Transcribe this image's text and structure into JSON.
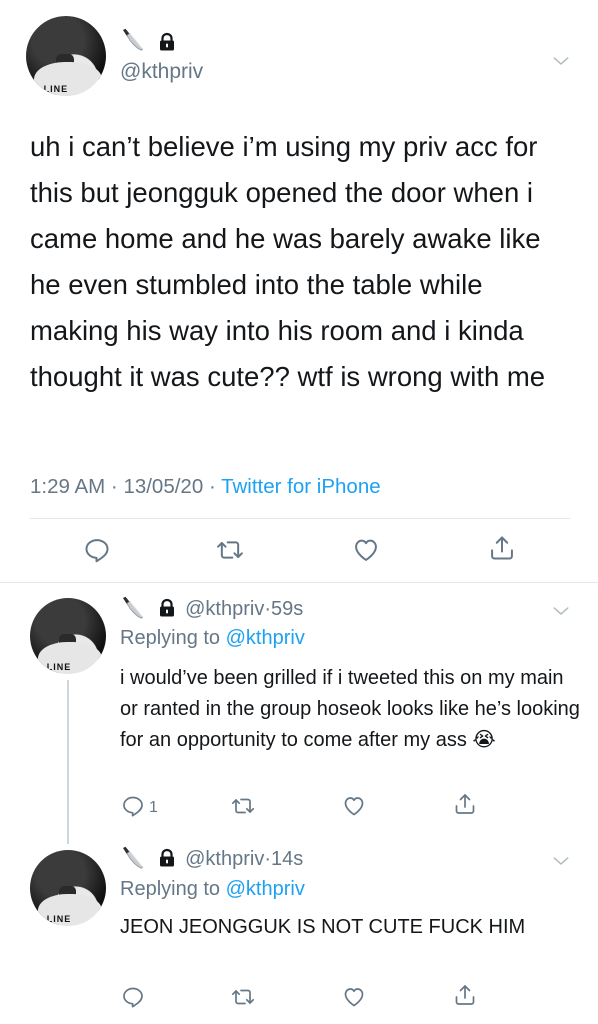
{
  "main_tweet": {
    "handle": "@kthpriv",
    "text": "uh i can’t believe i’m using my priv acc for this but jeongguk opened the door when i came home and he was barely awake like he even stumbled into the table while making his way into his room and i kinda thought it was cute?? wtf is wrong with me",
    "time": "1:29 AM",
    "date": "13/05/20",
    "source": "Twitter for iPhone",
    "separator": " · "
  },
  "replies": [
    {
      "handle": "@kthpriv",
      "age": "59s",
      "replying_prefix": "Replying to ",
      "replying_to": "@kthpriv",
      "text": "i would’ve been grilled if i tweeted this on my main or ranted in the group hoseok looks like he’s looking for an opportunity to come after my ass",
      "emoji": "😭",
      "reply_count": "1"
    },
    {
      "handle": "@kthpriv",
      "age": "14s",
      "replying_prefix": "Replying to ",
      "replying_to": "@kthpriv",
      "text": "JEON JEONGGUK IS NOT CUTE FUCK HIM"
    }
  ],
  "avatar_print": "LINE",
  "icons": {
    "reply": "reply-icon",
    "retweet": "retweet-icon",
    "like": "heart-icon",
    "share": "share-icon",
    "caret": "chevron-down-icon",
    "knife": "knife-emoji-icon",
    "lock": "lock-icon"
  },
  "colors": {
    "text": "#14171a",
    "muted": "#657786",
    "link": "#1da1f2",
    "divider": "#e1e8ed",
    "icon": "#657786"
  }
}
